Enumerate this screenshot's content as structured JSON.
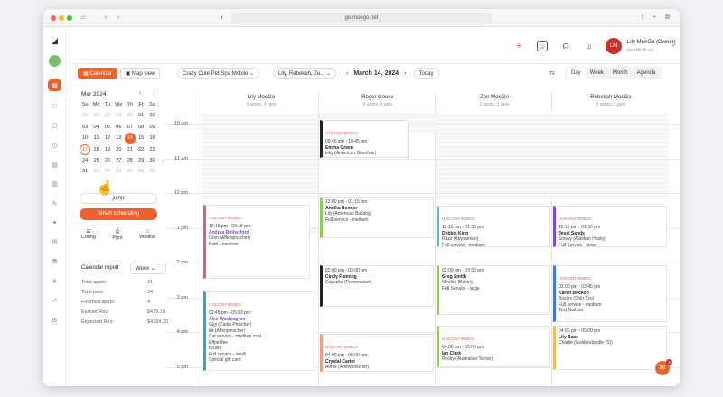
{
  "browser": {
    "url": "go.moego.pet"
  },
  "header": {
    "user_name": "Lily MoeGo (Owner)",
    "user_sub": "test(MultiLoc)",
    "avatar": "LM"
  },
  "toolbar": {
    "calendar": "Calendar",
    "map_view": "Map view",
    "business": "Crazy Cute Pet Spa Mobile",
    "staff": "Lily, Rebekah, Ze...",
    "date": "March 14, 2024",
    "today": "Today",
    "views": [
      "Day",
      "Week",
      "Month",
      "Agenda"
    ]
  },
  "mini_cal": {
    "month": "Mar 2024",
    "dow": [
      "Su",
      "Mo",
      "Tu",
      "We",
      "Th",
      "Fr",
      "Sa"
    ],
    "weeks": [
      [
        "25",
        "26",
        "27",
        "28",
        "29",
        "01",
        "02"
      ],
      [
        "03",
        "04",
        "05",
        "06",
        "07",
        "08",
        "09"
      ],
      [
        "10",
        "11",
        "12",
        "13",
        "14",
        "15",
        "16"
      ],
      [
        "17",
        "18",
        "19",
        "20",
        "21",
        "22",
        "23"
      ],
      [
        "24",
        "25",
        "26",
        "27",
        "28",
        "29",
        "30"
      ],
      [
        "31",
        "01",
        "02",
        "03",
        "04",
        "05",
        "06"
      ]
    ]
  },
  "left": {
    "jump": "jump",
    "smart": "Smart scheduling",
    "config": "Config",
    "print": "Print",
    "waitlist": "Waitlist",
    "report_title": "Calendar report",
    "report_period": "Week",
    "stats": [
      {
        "k": "Total appts:",
        "v": "31"
      },
      {
        "k": "Total pets:",
        "v": "34"
      },
      {
        "k": "Finished appts:",
        "v": "4"
      },
      {
        "k": "Earned Rev:",
        "v": "$479.16"
      },
      {
        "k": "Expected Rev:",
        "v": "$4384.20"
      }
    ]
  },
  "times": [
    "10 am",
    "11 am",
    "12 pm",
    "1 pm",
    "2 pm",
    "3 pm",
    "4 pm",
    "5 pm"
  ],
  "columns": [
    {
      "name": "Lily MoeGo",
      "sub": "3 appts, 4 pets"
    },
    {
      "name": "Roger Gouse",
      "sub": "4 appts, 4 pets"
    },
    {
      "name": "Zoe MoeGo",
      "sub": "3 appts, 3 pets"
    },
    {
      "name": "Rebekah MoeGo",
      "sub": "3 appts, 3 pets"
    }
  ],
  "events": [
    {
      "u": "UNCONFIRMED",
      "t": "09:45 am - 10:45 am",
      "n": "Emma Green",
      "pet": "kitty (American Shorthair)"
    },
    {
      "u": "UNCONFIRMED",
      "t": "12:15 pm - 02:15 pm",
      "n": "Andrea Rutherford",
      "pet": "Grim (Affenpinscher)",
      "svc": "Bath - medium"
    },
    {
      "u": "",
      "t": "12:00 pm - 01:15 pm",
      "n": "Annika Benner",
      "pet": "Lily (American Bulldog)",
      "svc": "Full service - medium"
    },
    {
      "u": "UNCONFIRMED",
      "t": "12:15 pm - 01:30 pm",
      "n": "Debbie King",
      "pet": "Razz (Abyssinian)",
      "svc": "Full service - medium"
    },
    {
      "u": "UNCONFIRMED",
      "t": "12:15 pm - 01:30 pm",
      "n": "Jessi Sands",
      "pet": "Snowy (Alaskan Husky)",
      "svc": "Full Service - large"
    },
    {
      "u": "",
      "t": "02:00 pm - 03:00 pm",
      "n": "Cindy Fanning",
      "pet": "Cupcake (Pomeranian)"
    },
    {
      "u": "",
      "t": "02:00 pm - 03:30 pm",
      "n": "Greg Smith",
      "pet": "Meekie (Boxer)",
      "svc": "Full Service - large"
    },
    {
      "u": "UNCONFIRMED",
      "t": "02:00 pm - 03:45 pm",
      "n": "Karen Beckon",
      "pet": "Bosley (Shih Tzu)",
      "svc": "Full service - medium",
      "svc2": "Test Nail cla"
    },
    {
      "u": "UNCONFIRMED",
      "t": "02:45 pm - 05:03 pm",
      "n": "Alex Washington",
      "pet": "Gigi (Carlin Pinscher)",
      "pet2": "ka (Affenpinscher)",
      "svc": "Cat service - medium coat",
      "svc2": "Effpei fee",
      "svc3": "Brush",
      "svc4": "Full service - small",
      "svc5": "Special gift card"
    },
    {
      "u": "UNCONFIRMED",
      "t": "04:00 pm - 05:00 pm",
      "n": "Crystal Carter",
      "pet": "Annie (Affenpinscher)"
    },
    {
      "u": "UNCONFIRMED",
      "t": "04:00 pm - 05:00 pm",
      "n": "Ian Clark",
      "pet": "Rocky (Australian Terrier)"
    },
    {
      "u": "",
      "t": "04:00 pm - 05:00 pm",
      "n": "Lily Baez",
      "pet": "Charlie (Goldendoodle (S))"
    }
  ],
  "chat_badge": "4"
}
